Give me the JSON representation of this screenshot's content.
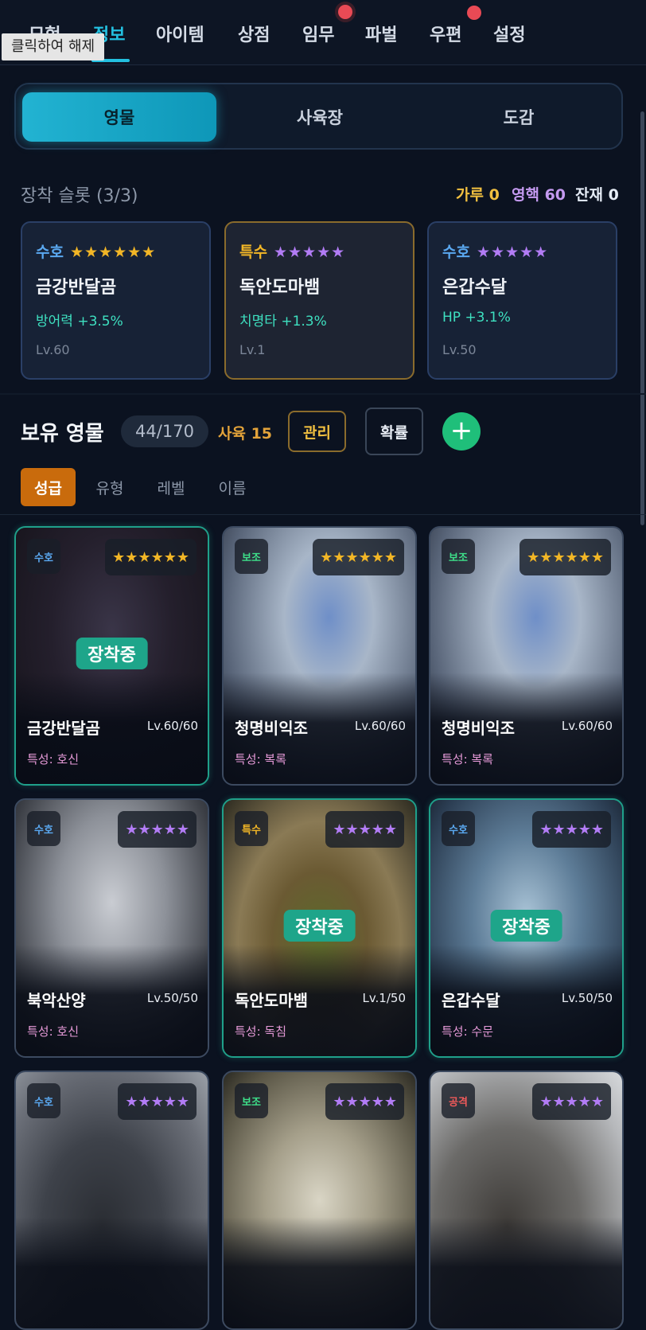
{
  "nav": {
    "tabs": [
      "모험",
      "정보",
      "아이템",
      "상점",
      "임무",
      "파벌",
      "우편",
      "설정"
    ],
    "active": "정보",
    "tooltip": "클릭하여 해제"
  },
  "segments": [
    "영물",
    "사육장",
    "도감"
  ],
  "slots": {
    "title": "장착 슬롯 (3/3)",
    "resources": [
      {
        "label": "가루 0",
        "color": "#f2c040"
      },
      {
        "label": "영핵 60",
        "color": "#c49af0"
      },
      {
        "label": "잔재 0",
        "color": "#e6edf7"
      }
    ],
    "items": [
      {
        "type": "수호",
        "stars": "★★★★★★",
        "star_color": "#f2b626",
        "name": "금강반달곰",
        "bonus": "방어력 +3.5%",
        "level": "Lv.60"
      },
      {
        "type": "특수",
        "stars": "★★★★★",
        "star_color": "#b27cf5",
        "name": "독안도마뱀",
        "bonus": "치명타 +1.3%",
        "level": "Lv.1"
      },
      {
        "type": "수호",
        "stars": "★★★★★",
        "star_color": "#b27cf5",
        "name": "은갑수달",
        "bonus": "HP +3.1%",
        "level": "Lv.50"
      }
    ]
  },
  "owned": {
    "title": "보유 영물",
    "count": "44/170",
    "raise": "사육 15",
    "manage": "관리",
    "probability": "확률",
    "add": "+"
  },
  "sort_tabs": [
    "성급",
    "유형",
    "레벨",
    "이름"
  ],
  "equip_label": "장착중",
  "cards": [
    {
      "type": "수호",
      "stars": "★★★★★★",
      "name": "금강반달곰",
      "level": "Lv.60/60",
      "trait": "특성: 호신",
      "equipped": true
    },
    {
      "type": "보조",
      "stars": "★★★★★★",
      "name": "청명비익조",
      "level": "Lv.60/60",
      "trait": "특성: 복록",
      "equipped": false
    },
    {
      "type": "보조",
      "stars": "★★★★★★",
      "name": "청명비익조",
      "level": "Lv.60/60",
      "trait": "특성: 복록",
      "equipped": false
    },
    {
      "type": "수호",
      "stars": "★★★★★",
      "name": "북악산양",
      "level": "Lv.50/50",
      "trait": "특성: 호신",
      "equipped": false
    },
    {
      "type": "특수",
      "stars": "★★★★★",
      "name": "독안도마뱀",
      "level": "Lv.1/50",
      "trait": "특성: 독침",
      "equipped": true
    },
    {
      "type": "수호",
      "stars": "★★★★★",
      "name": "은갑수달",
      "level": "Lv.50/50",
      "trait": "특성: 수문",
      "equipped": true
    },
    {
      "type": "수호",
      "stars": "★★★★★",
      "name": "",
      "level": "",
      "trait": "",
      "equipped": false
    },
    {
      "type": "보조",
      "stars": "★★★★★",
      "name": "",
      "level": "",
      "trait": "",
      "equipped": false
    },
    {
      "type": "공격",
      "stars": "★★★★★",
      "name": "",
      "level": "",
      "trait": "",
      "equipped": false
    }
  ],
  "colors": {
    "accent": "#23c0e0",
    "guard_type": "#5aa8f0",
    "support_type": "#3ee08a",
    "special_type": "#f2b626",
    "attack_type": "#f05a5a",
    "six_star": "#f2b626",
    "five_star": "#b27cf5",
    "equipped": "#1ea58a"
  }
}
